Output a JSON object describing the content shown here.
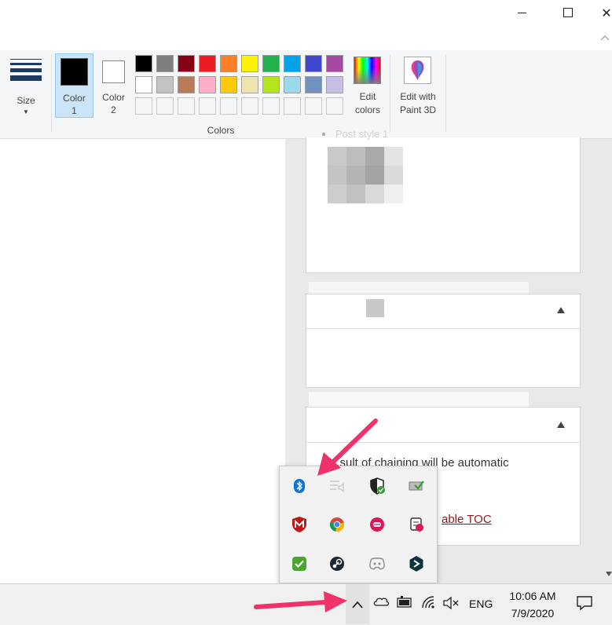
{
  "window": {
    "minimize_glyph": "—",
    "maximize_glyph": "☐",
    "collapse_glyph": "︿"
  },
  "ribbon": {
    "size_label": "Size",
    "color1_label": "Color",
    "color1_num": "1",
    "color2_label": "Color",
    "color2_num": "2",
    "colors_group_label": "Colors",
    "edit_colors_line1": "Edit",
    "edit_colors_line2": "colors",
    "paint3d_line1": "Edit with",
    "paint3d_line2": "Paint 3D",
    "color1_value": "#000000",
    "color2_value": "#ffffff",
    "palette_row1": [
      "#000000",
      "#7f7f7f",
      "#880015",
      "#ed1c24",
      "#ff7f27",
      "#fff200",
      "#22b14c",
      "#00a2e8",
      "#3f48cc",
      "#a349a4"
    ],
    "palette_row2": [
      "#ffffff",
      "#c3c3c3",
      "#b97a57",
      "#ffaec9",
      "#ffc90e",
      "#efe4b0",
      "#b5e61d",
      "#99d9ea",
      "#7092be",
      "#c8bfe7"
    ]
  },
  "content": {
    "post_style_label": "Post style 1",
    "notice_text": "...sult of chaining will be automatic",
    "toc_link": "able TOC"
  },
  "tray_icons": [
    "bluetooth-icon",
    "volume-mixer-icon",
    "windows-security-icon",
    "network-check-icon",
    "mcafee-icon",
    "chrome-icon",
    "pocket-casts-icon",
    "snip-sketch-icon",
    "security-check-icon",
    "steam-icon",
    "discord-icon",
    "dashlane-icon"
  ],
  "taskbar": {
    "chevron": "^",
    "lang": "ENG",
    "time": "10:06 AM",
    "date": "7/9/2020"
  },
  "accent": "#f0326a"
}
